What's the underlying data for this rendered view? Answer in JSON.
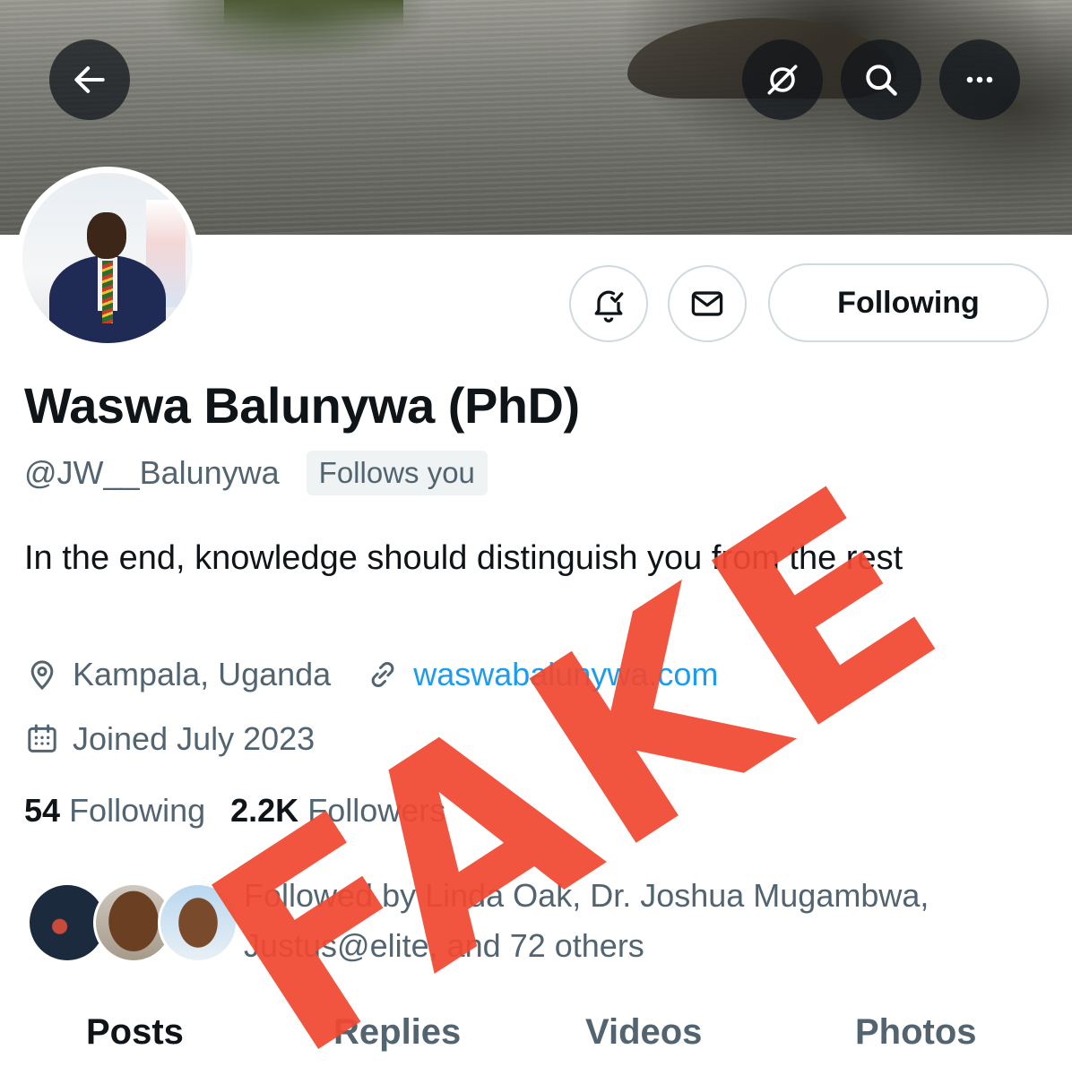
{
  "header": {
    "back_icon": "arrow-left-icon",
    "grok_icon": "grok-icon",
    "search_icon": "search-icon",
    "more_icon": "more-horizontal-icon"
  },
  "actions": {
    "notify_icon": "bell-check-icon",
    "message_icon": "envelope-icon",
    "following_label": "Following"
  },
  "profile": {
    "display_name": "Waswa Balunywa (PhD)",
    "handle": "@JW__Balunywa",
    "follows_you": "Follows you",
    "bio": "In the end, knowledge should distinguish you from the rest",
    "location": "Kampala, Uganda",
    "website": "waswabalunywa.com",
    "joined": "Joined July 2023",
    "following_count": "54",
    "following_label": "Following",
    "followers_count": "2.2K",
    "followers_label": "Followers",
    "followed_by": "Followed by Linda Oak, Dr. Joshua Mugambwa, Justus@elite, and 72 others"
  },
  "tabs": [
    {
      "label": "Posts",
      "active": true
    },
    {
      "label": "Replies",
      "active": false
    },
    {
      "label": "Videos",
      "active": false
    },
    {
      "label": "Photos",
      "active": false
    }
  ],
  "overlay": {
    "stamp_text": "FAKE",
    "stamp_color": "#f14830"
  },
  "colors": {
    "text_primary": "#0f1419",
    "text_secondary": "#536471",
    "link": "#1d9bf0",
    "border": "#cfd9de"
  }
}
